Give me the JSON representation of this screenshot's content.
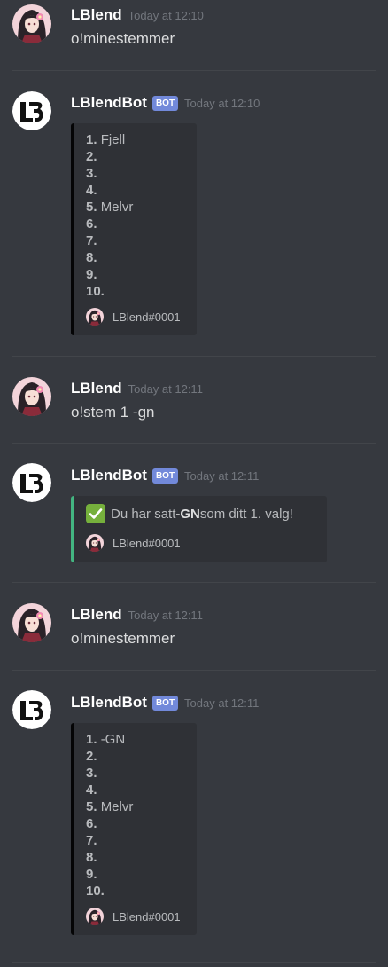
{
  "users": {
    "lblend": {
      "name": "LBlend"
    },
    "bot": {
      "name": "LBlendBot",
      "tag": "BOT"
    }
  },
  "messages": [
    {
      "author": "LBlend",
      "timestamp": "Today at 12:10",
      "text": "o!minestemmer"
    },
    {
      "author": "LBlendBot",
      "tag": "BOT",
      "timestamp": "Today at 12:10",
      "embed": {
        "rows": [
          {
            "num": "1.",
            "value": "Fjell"
          },
          {
            "num": "2.",
            "value": ""
          },
          {
            "num": "3.",
            "value": ""
          },
          {
            "num": "4.",
            "value": ""
          },
          {
            "num": "5.",
            "value": "Melvr"
          },
          {
            "num": "6.",
            "value": ""
          },
          {
            "num": "7.",
            "value": ""
          },
          {
            "num": "8.",
            "value": ""
          },
          {
            "num": "9.",
            "value": ""
          },
          {
            "num": "10.",
            "value": ""
          }
        ],
        "footer": "LBlend#0001"
      }
    },
    {
      "author": "LBlend",
      "timestamp": "Today at 12:11",
      "text": "o!stem 1 -gn"
    },
    {
      "author": "LBlendBot",
      "tag": "BOT",
      "timestamp": "Today at 12:11",
      "embed": {
        "text_before": "Du har satt ",
        "text_bold": "-GN",
        "text_after": " som ditt 1. valg!",
        "footer": "LBlend#0001"
      }
    },
    {
      "author": "LBlend",
      "timestamp": "Today at 12:11",
      "text": "o!minestemmer"
    },
    {
      "author": "LBlendBot",
      "tag": "BOT",
      "timestamp": "Today at 12:11",
      "embed": {
        "rows": [
          {
            "num": "1.",
            "value": "-GN"
          },
          {
            "num": "2.",
            "value": ""
          },
          {
            "num": "3.",
            "value": ""
          },
          {
            "num": "4.",
            "value": ""
          },
          {
            "num": "5.",
            "value": "Melvr"
          },
          {
            "num": "6.",
            "value": ""
          },
          {
            "num": "7.",
            "value": ""
          },
          {
            "num": "8.",
            "value": ""
          },
          {
            "num": "9.",
            "value": ""
          },
          {
            "num": "10.",
            "value": ""
          }
        ],
        "footer": "LBlend#0001"
      }
    }
  ],
  "colors": {
    "background": "#36393f",
    "embed_background": "#2f3136",
    "embed_border_default": "#040405",
    "embed_border_success": "#43b581",
    "bot_tag": "#7289da",
    "timestamp": "#72767d"
  },
  "icons": {
    "user_avatar": "anime-girl-avatar",
    "bot_avatar": "lb-logo-avatar",
    "confirm": "white-check-mark-icon"
  }
}
